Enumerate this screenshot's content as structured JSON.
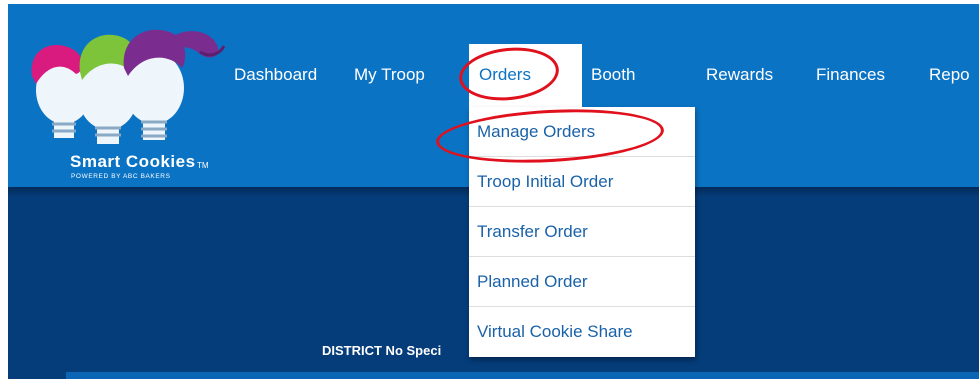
{
  "logo": {
    "wordmark": "Smart Cookies",
    "tm": "TM",
    "tagline": "POWERED BY ABC BAKERS"
  },
  "nav": {
    "items": [
      "Dashboard",
      "My Troop",
      "Orders",
      "Booth",
      "Rewards",
      "Finances",
      "Repo"
    ],
    "active": "Orders"
  },
  "orders_menu": {
    "items": [
      "Manage Orders",
      "Troop Initial Order",
      "Transfer Order",
      "Planned Order",
      "Virtual Cookie Share"
    ]
  },
  "banner": {
    "district_text": "DISTRICT No Speci"
  },
  "annotations": {
    "highlight_color": "#e0101c",
    "circled": [
      "Orders",
      "Manage Orders"
    ]
  },
  "colors": {
    "nav_bar": "#0b73c4",
    "banner": "#053c7a",
    "menu_text": "#1a62a8"
  }
}
